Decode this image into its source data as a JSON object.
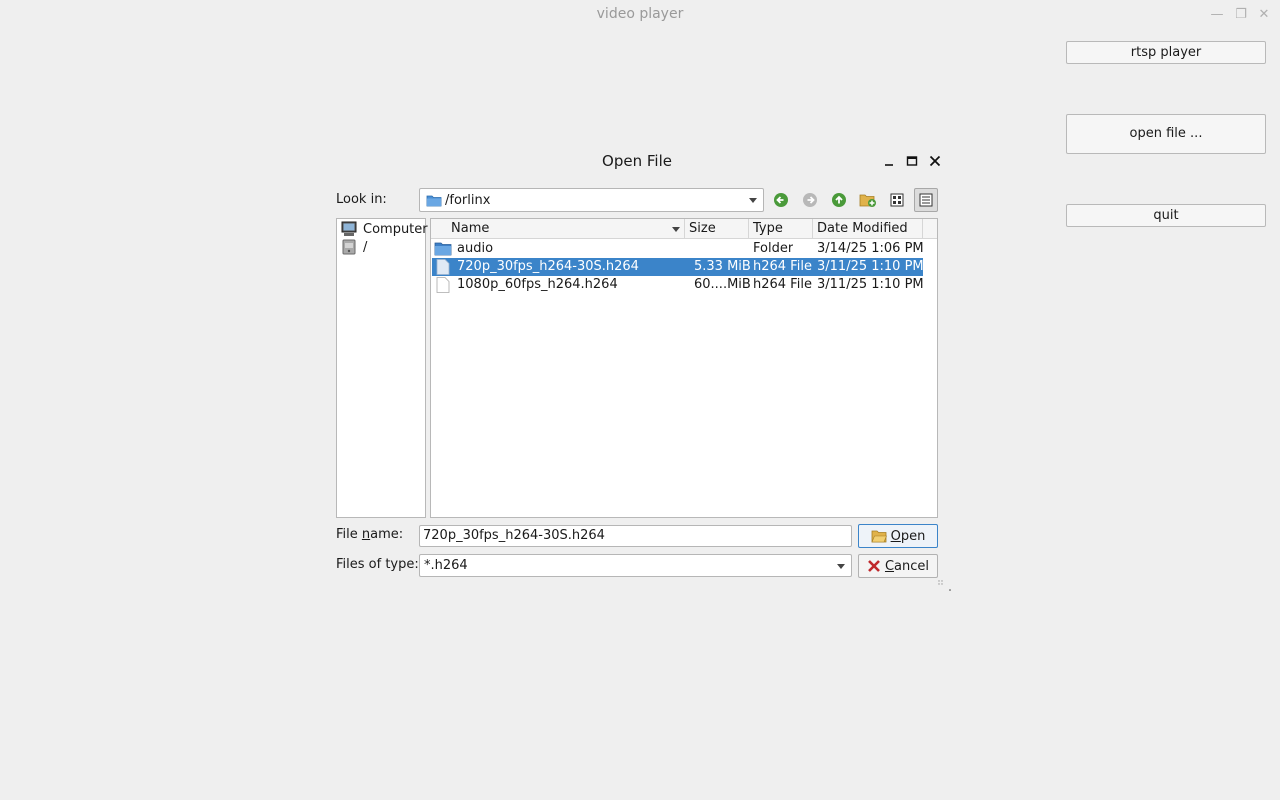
{
  "app": {
    "title": "video player",
    "buttons": {
      "rtsp": "rtsp player",
      "open_file": "open file ...",
      "quit": "quit"
    }
  },
  "dialog": {
    "title": "Open File",
    "look_in_label": "Look in:",
    "look_in_value": "/forlinx",
    "sidebar": [
      {
        "label": "Computer",
        "icon": "computer-icon"
      },
      {
        "label": "/",
        "icon": "drive-icon"
      }
    ],
    "columns": [
      "Name",
      "Size",
      "Type",
      "Date Modified"
    ],
    "files": [
      {
        "name": "audio",
        "size": "",
        "type": "Folder",
        "date": "3/14/25 1:06 PM",
        "icon": "folder-icon",
        "selected": false
      },
      {
        "name": "720p_30fps_h264-30S.h264",
        "size": "5.33 MiB",
        "type": "h264 File",
        "date": "3/11/25 1:10 PM",
        "icon": "file-icon",
        "selected": true
      },
      {
        "name": "1080p_60fps_h264.h264",
        "size": "60....MiB",
        "type": "h264 File",
        "date": "3/11/25 1:10 PM",
        "icon": "file-icon",
        "selected": false
      }
    ],
    "file_name_label_pre": "File ",
    "file_name_label_ul": "n",
    "file_name_label_post": "ame:",
    "file_name_value": "720p_30fps_h264-30S.h264",
    "files_of_type_label": "Files of type:",
    "files_of_type_value": "*.h264",
    "open_pre": "",
    "open_ul": "O",
    "open_post": "pen",
    "cancel_pre": "",
    "cancel_ul": "C",
    "cancel_post": "ancel"
  },
  "colors": {
    "selection": "#3b84c9",
    "background": "#efefef"
  }
}
